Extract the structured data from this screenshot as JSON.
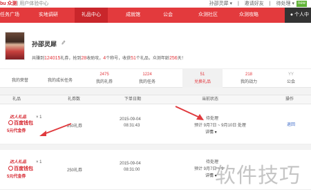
{
  "topbar": {
    "brand": "bu 众测",
    "brand_sub": "| 用户体验中心",
    "links": [
      "孙邵灵犀 ▾",
      "|",
      "邀请好友",
      "|",
      "待处理 ▾"
    ],
    "new_badge": "new"
  },
  "nav": {
    "items": [
      "任务广场",
      "实地调研",
      "礼品中心",
      "成就馆",
      "公会",
      "众测社区",
      "众测攻略"
    ],
    "user_corner": "个人中"
  },
  "profile": {
    "name": "孙邵灵犀",
    "stats": {
      "p1": "共赚到",
      "coins": "124015",
      "p2": "礼券，抢到",
      "grabs": "28",
      "p3": "收助攻，",
      "titles": "4",
      "p4": "个称号，收获",
      "gifts": "51",
      "p5": "个礼品，众测年龄",
      "days": "256",
      "p6": "天！"
    }
  },
  "tabs": [
    {
      "num": "",
      "label": "我的荣誉"
    },
    {
      "num": "",
      "label": "我的成长任务"
    },
    {
      "num": "2475",
      "label": "我的礼券"
    },
    {
      "num": "1224",
      "label": "我的任务"
    },
    {
      "num": "51",
      "label": "兑换礼品"
    },
    {
      "num": "218",
      "label": "我的战力"
    },
    {
      "num": "YY",
      "label": "公会"
    }
  ],
  "table": {
    "headers": [
      "礼品",
      "礼券数",
      "下单日期",
      "当前状态",
      "操作"
    ],
    "rows": [
      {
        "logo": "达人礼品",
        "bank": "百度钱包",
        "coupon": "5元代金券",
        "qty": "× 1",
        "coupons": "250礼券",
        "date": "2015-09-04",
        "time": "08:31:43",
        "status": "待处理",
        "expect": "预计 9月7日 ~ 9月10日 处理",
        "detail": "详情 ▾",
        "action": "退回"
      },
      {
        "logo": "达人礼品",
        "bank": "百度钱包",
        "coupon": "5元代金券",
        "qty": "× 1",
        "coupons": "250礼券",
        "date": "2015-09-04",
        "time": "08:31:00",
        "status": "待处理",
        "expect": "预计 9月7日 ~ 9",
        "detail": "详情 ▾",
        "action": ""
      }
    ]
  },
  "watermark": "软件技巧",
  "colors": {
    "nav": "#e33a3d",
    "accent": "#e3343a",
    "link": "#3a68c8",
    "arrow": "#e03a3e"
  }
}
